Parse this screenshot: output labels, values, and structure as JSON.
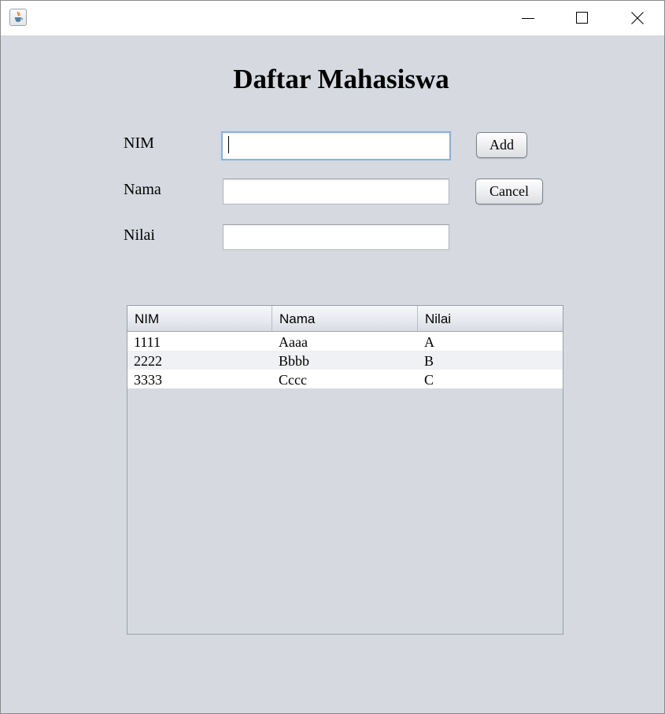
{
  "window": {
    "title": "",
    "icon": "java-cup-icon",
    "controls": {
      "minimize": "minimize-icon",
      "maximize": "maximize-icon",
      "close": "close-icon"
    }
  },
  "form": {
    "heading": "Daftar Mahasiswa",
    "fields": [
      {
        "label": "NIM",
        "value": "",
        "focused": true
      },
      {
        "label": "Nama",
        "value": ""
      },
      {
        "label": "Nilai",
        "value": ""
      }
    ],
    "add_label": "Add",
    "cancel_label": "Cancel"
  },
  "table": {
    "columns": [
      "NIM",
      "Nama",
      "Nilai"
    ],
    "rows": [
      [
        "1111",
        "Aaaa",
        "A"
      ],
      [
        "2222",
        "Bbbb",
        "B"
      ],
      [
        "3333",
        "Cccc",
        "C"
      ]
    ]
  },
  "colors": {
    "background": "#d6d9e0",
    "focus_border": "#8fb1d6"
  }
}
